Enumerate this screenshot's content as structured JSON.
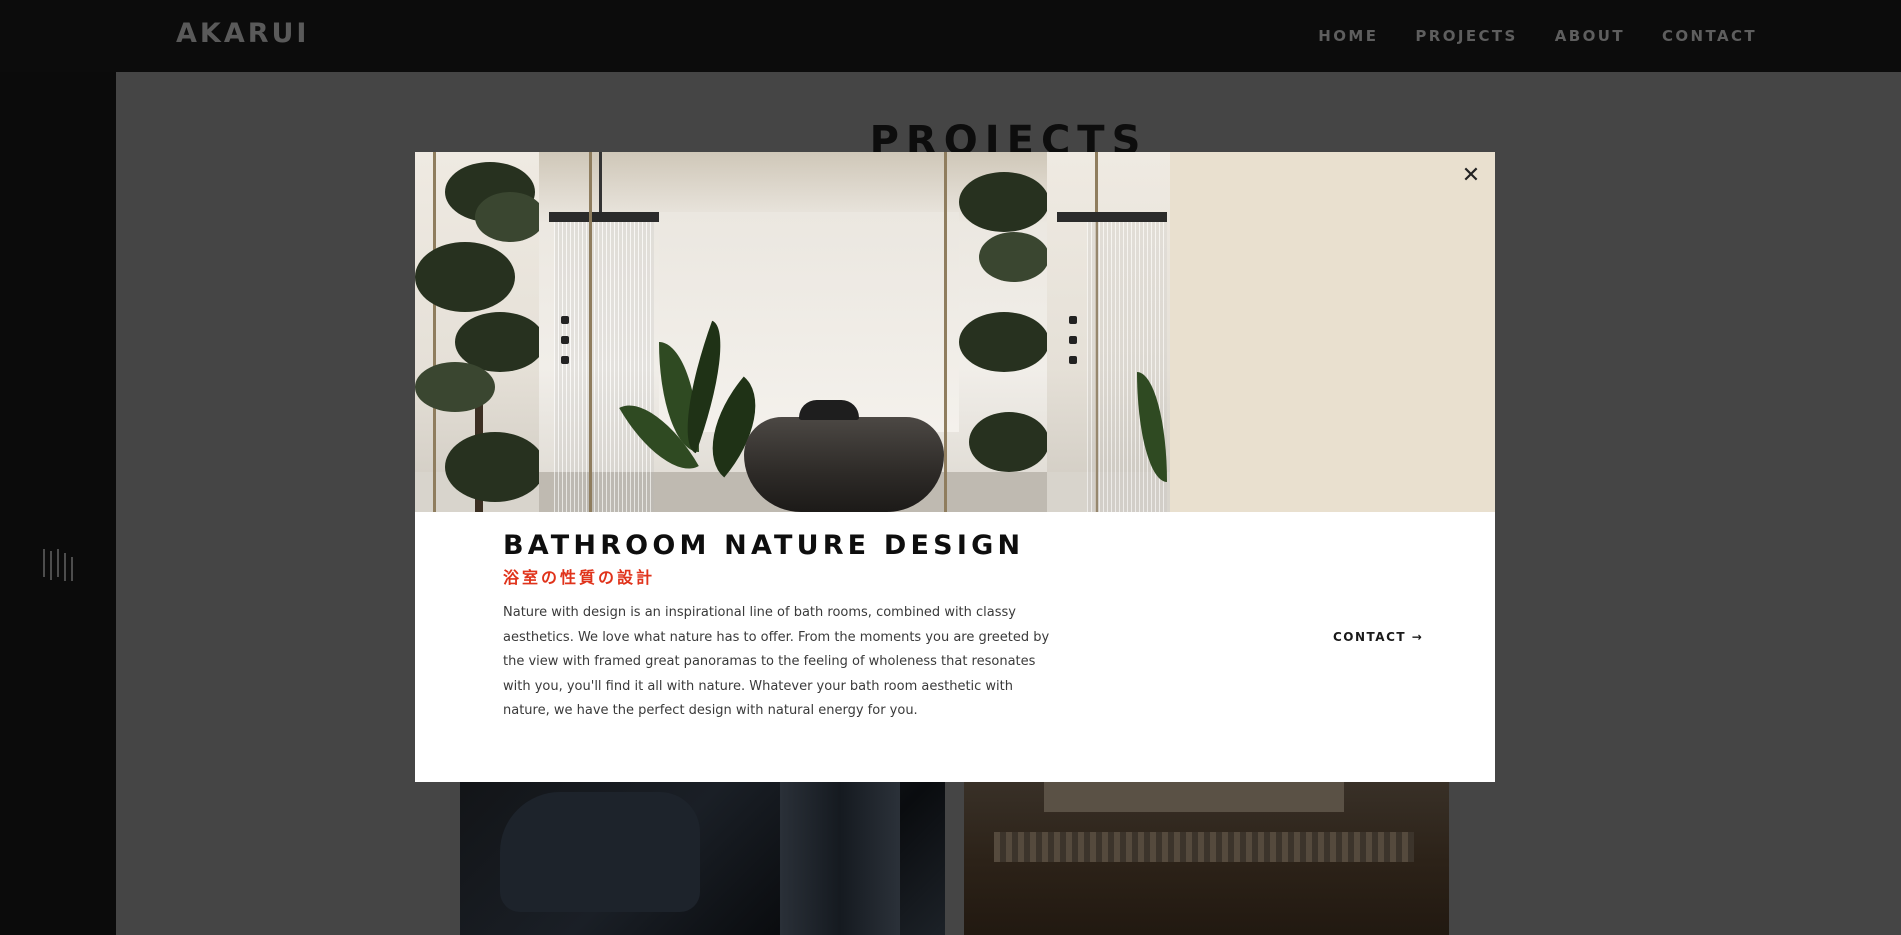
{
  "header": {
    "logo": "AKARUI",
    "nav": [
      "HOME",
      "PROJECTS",
      "ABOUT",
      "CONTACT"
    ]
  },
  "sidebar": {
    "icon": "bars-icon"
  },
  "main": {
    "title": "PROJECTS"
  },
  "modal": {
    "close_icon": "close-icon",
    "close_glyph": "✕",
    "title": "BATHROOM NATURE DESIGN",
    "subtitle": "浴室の性質の設計",
    "description": "Nature with design is an inspirational line of bath rooms, combined with classy aesthetics. We love what nature has to offer. From the moments you are greeted by the view with framed great panoramas to the feeling of wholeness that resonates with you, you'll find it all with nature. Whatever your bath room aesthetic with nature, we have the perfect design with natural energy for you.",
    "contact_label": "CONTACT →"
  },
  "colors": {
    "accent": "#e0331b",
    "hero_background": "#e9e0cf",
    "overlay": "#454545"
  }
}
